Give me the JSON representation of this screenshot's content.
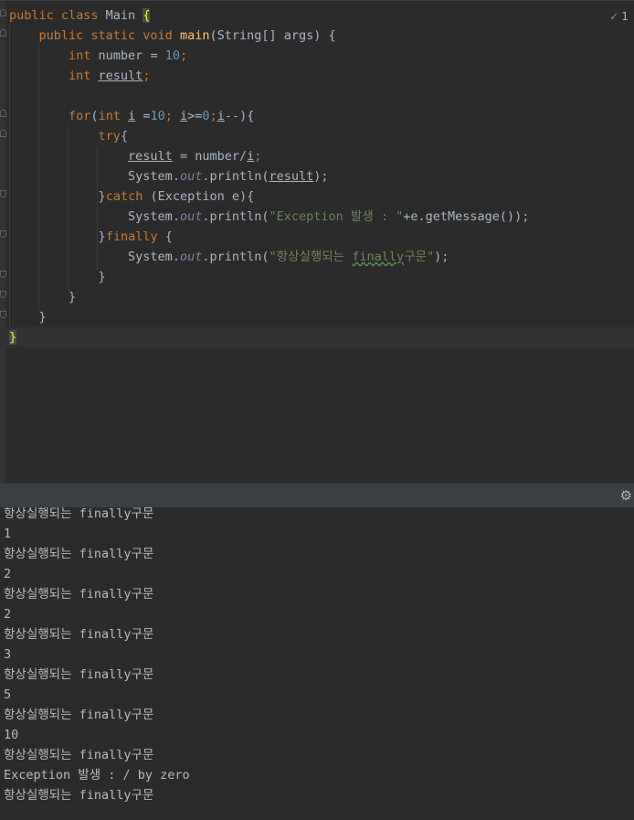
{
  "inspection": {
    "count": "1"
  },
  "code": {
    "l1": {
      "a": "public class ",
      "b": "Main ",
      "c": "{"
    },
    "l2": {
      "a": "public static void ",
      "b": "main",
      "c": "(String[] args) {"
    },
    "l3": {
      "a": "int ",
      "b": "number = ",
      "c": "10",
      "d": ";"
    },
    "l4": {
      "a": "int ",
      "b": "result",
      "c": ";"
    },
    "l6": {
      "a": "for",
      "b": "(",
      "c": "int ",
      "d": "i",
      "e": " =",
      "f": "10",
      "g": "; ",
      "h": "i",
      "i": ">=",
      "j": "0",
      "k": ";",
      "l": "i",
      "m": "--){"
    },
    "l7": {
      "a": "try",
      "b": "{"
    },
    "l8": {
      "a": "result",
      "b": " = number/",
      "c": "i",
      "d": ";"
    },
    "l9": {
      "a": "System.",
      "b": "out",
      "c": ".println(",
      "d": "result",
      "e": ");"
    },
    "l10": {
      "a": "}",
      "b": "catch ",
      "c": "(Exception e){"
    },
    "l11": {
      "a": "System.",
      "b": "out",
      "c": ".println(",
      "d": "\"Exception 발생 : \"",
      "e": "+e.getMessage());"
    },
    "l12": {
      "a": "}",
      "b": "finally ",
      "c": "{"
    },
    "l13": {
      "a": "System.",
      "b": "out",
      "c": ".println(",
      "d": "\"항상실행되는 ",
      "e": "finally",
      "f": "구문\"",
      "g": ");"
    },
    "l14": "}",
    "l15": "}",
    "l16": "}",
    "l17": "}"
  },
  "console": {
    "lines": [
      "항상실행되는 finally구문",
      "1",
      "항상실행되는 finally구문",
      "2",
      "항상실행되는 finally구문",
      "2",
      "항상실행되는 finally구문",
      "3",
      "항상실행되는 finally구문",
      "5",
      "항상실행되는 finally구문",
      "10",
      "항상실행되는 finally구문",
      "Exception 발생 : / by zero",
      "항상실행되는 finally구문"
    ]
  },
  "icons": {
    "gear": "gear-icon",
    "check": "inspection-check-icon"
  }
}
